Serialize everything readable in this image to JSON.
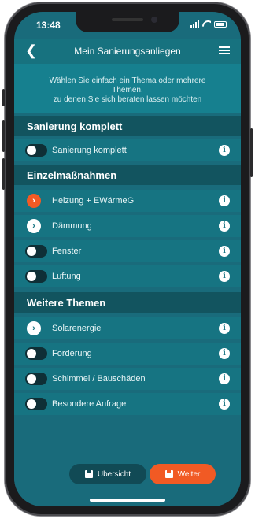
{
  "status_bar": {
    "time": "13:48"
  },
  "header": {
    "title": "Mein Sanierungsanliegen",
    "back_icon": "chevron-left-icon",
    "menu_icon": "hamburger-menu-icon"
  },
  "intro": {
    "line1": "Wählen Sie einfach ein Thema oder mehrere",
    "line2": "Themen,",
    "line3": "zu denen Sie sich beraten lassen möchten"
  },
  "sections": {
    "komplett": {
      "title": "Sanierung komplett",
      "items": [
        {
          "label": "Sanierung komplett",
          "control": "toggle"
        }
      ]
    },
    "einzel": {
      "title": "Einzelmaßnahmen",
      "items": [
        {
          "label": "Heizung + EWärmeG",
          "control": "chevron-active"
        },
        {
          "label": "Dämmung",
          "control": "chevron"
        },
        {
          "label": "Fenster",
          "control": "toggle"
        },
        {
          "label": "Luftung",
          "control": "toggle"
        }
      ]
    },
    "weitere": {
      "title": "Weitere Themen",
      "items": [
        {
          "label": "Solarenergie",
          "control": "chevron"
        },
        {
          "label": "Forderung",
          "control": "toggle"
        },
        {
          "label": "Schimmel / Bauschäden",
          "control": "toggle"
        },
        {
          "label": "Besondere Anfrage",
          "control": "toggle"
        }
      ]
    }
  },
  "info_glyph": "i",
  "chevron_glyph": "›",
  "footer": {
    "overview_label": "Ubersicht",
    "next_label": "Weiter"
  },
  "colors": {
    "accent": "#f15a24",
    "background": "#196b7b",
    "section": "#12545f",
    "row": "#167482"
  }
}
